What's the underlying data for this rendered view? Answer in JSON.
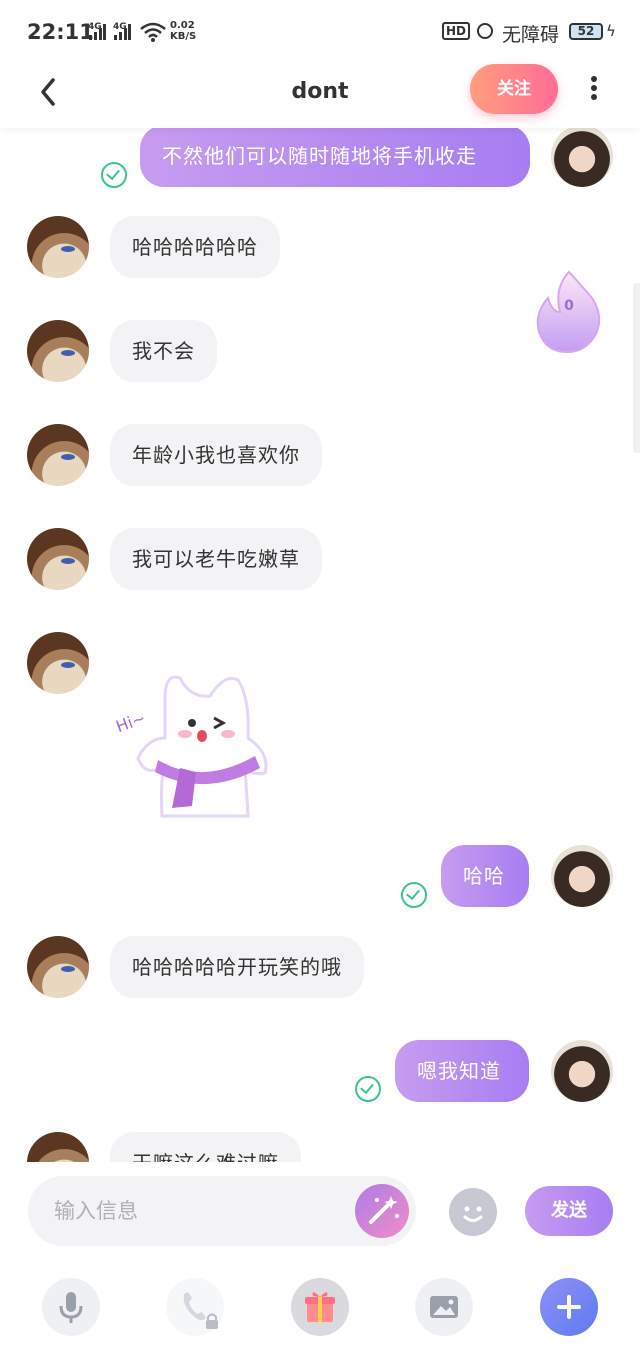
{
  "status_bar": {
    "time": "22:11",
    "signal_1": "4G",
    "signal_2": "4G",
    "speed_value": "0.02",
    "speed_unit": "KB/S",
    "hd": "HD",
    "accessibility": "无障碍",
    "battery": "52"
  },
  "header": {
    "title": "dont",
    "follow_label": "关注"
  },
  "flame": {
    "count": "0"
  },
  "messages": [
    {
      "side": "out",
      "text": "不然他们可以随时随地将手机收走",
      "read": true
    },
    {
      "side": "in",
      "text": "哈哈哈哈哈哈"
    },
    {
      "side": "in",
      "text": "我不会"
    },
    {
      "side": "in",
      "text": "年龄小我也喜欢你"
    },
    {
      "side": "in",
      "text": "我可以老牛吃嫩草"
    },
    {
      "side": "in",
      "type": "sticker",
      "sticker_text": "Hi~"
    },
    {
      "side": "out",
      "text": "哈哈",
      "read": true
    },
    {
      "side": "in",
      "text": "哈哈哈哈哈开玩笑的哦"
    },
    {
      "side": "out",
      "text": "嗯我知道",
      "read": true
    },
    {
      "side": "in",
      "text": "干嘛这么难过嘛"
    }
  ],
  "input": {
    "placeholder": "输入信息",
    "send_label": "发送"
  },
  "toolbar": {
    "icons": [
      "microphone-icon",
      "phone-icon",
      "gift-icon",
      "image-icon",
      "plus-icon"
    ]
  },
  "colors": {
    "accent_purple": "#a77df2",
    "follow_gradient_start": "#ff9d7e",
    "follow_gradient_end": "#ff6d96",
    "read_check": "#3dc48a",
    "incoming_bubble": "#f3f3f6"
  }
}
